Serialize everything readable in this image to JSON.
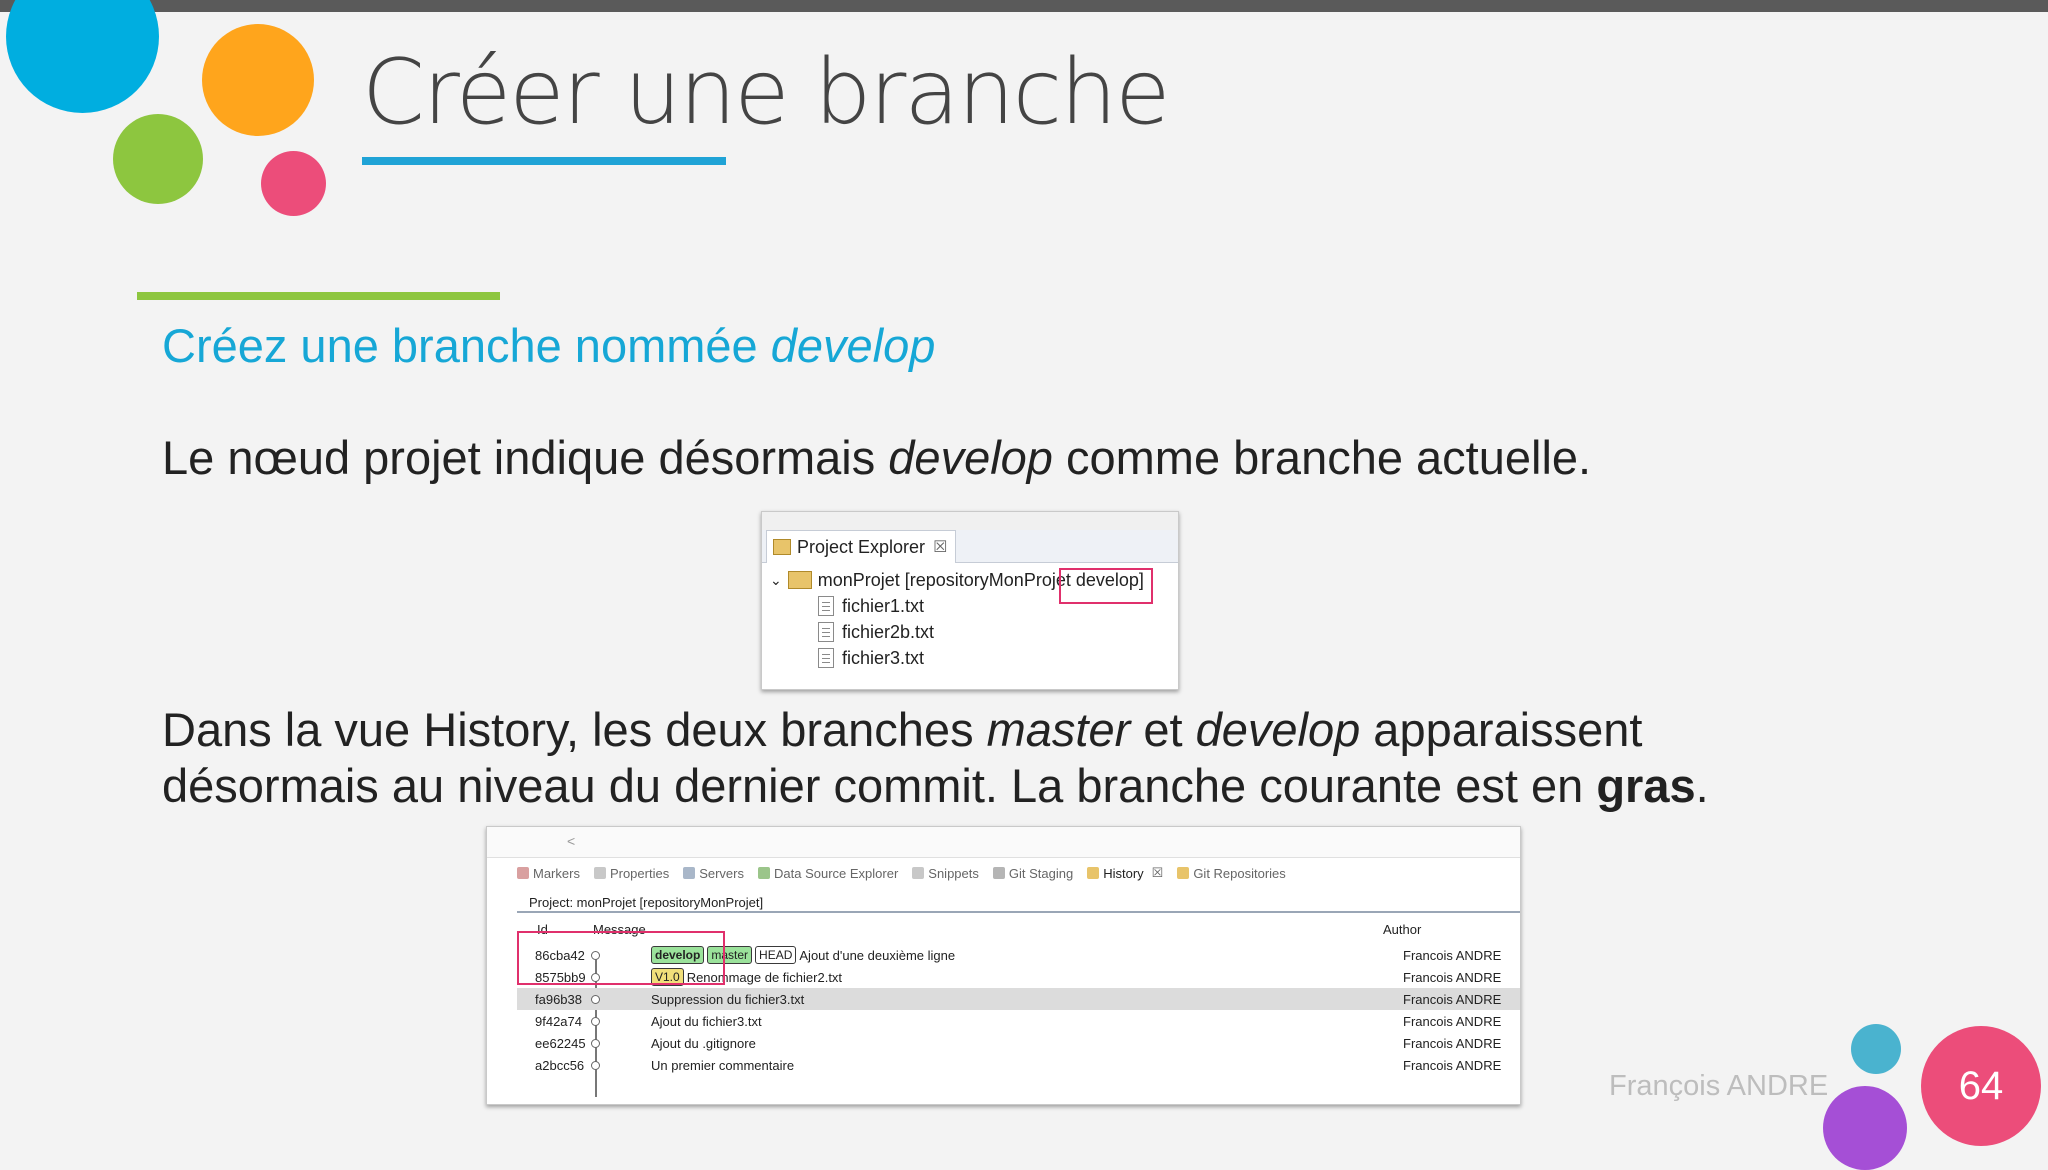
{
  "slide": {
    "title": "Créer une branche",
    "subtitle_prefix": "Créez une branche nommée ",
    "subtitle_em": "develop",
    "para1": {
      "a": "Le nœud projet indique désormais ",
      "em": "develop",
      "b": " comme branche actuelle."
    },
    "para2": {
      "line1_a": "Dans la vue History, les deux branches ",
      "line1_em1": "master",
      "line1_b": " et ",
      "line1_em2": "develop",
      "line1_c": " apparaissent",
      "line2_a": "désormais au niveau du dernier commit. La branche courante est en ",
      "line2_bold": "gras",
      "line2_end": "."
    },
    "author": "François ANDRE",
    "page_number": "64",
    "colors": {
      "blue": "#00aee0",
      "orange": "#ffa51c",
      "green": "#8dc63f",
      "pink": "#ec4d7a",
      "teal": "#4ab3cf",
      "purple": "#a54fd6",
      "subtitle": "#16a7d6"
    }
  },
  "project_explorer": {
    "tab_label": "Project Explorer",
    "tab_close": "☒",
    "project_node": "monProjet [repositoryMonProjet develop]",
    "files": [
      "fichier1.txt",
      "fichier2b.txt",
      "fichier3.txt"
    ]
  },
  "history": {
    "scroll_arrow": "<",
    "tabs": [
      "Markers",
      "Properties",
      "Servers",
      "Data Source Explorer",
      "Snippets",
      "Git Staging",
      "History",
      "Git Repositories"
    ],
    "active_tab": "History",
    "project_label": "Project: monProjet [repositoryMonProjet]",
    "columns": {
      "id": "Id",
      "message": "Message",
      "author": "Author"
    },
    "rows": [
      {
        "id": "86cba42",
        "tags": [
          "develop",
          "master",
          "HEAD"
        ],
        "message": "Ajout d'une deuxième ligne",
        "author": "Francois ANDRE"
      },
      {
        "id": "8575bb9",
        "tags": [
          "V1.0"
        ],
        "message": "Renommage de fichier2.txt",
        "author": "Francois ANDRE"
      },
      {
        "id": "fa96b38",
        "tags": [],
        "message": "Suppression du fichier3.txt",
        "author": "Francois ANDRE"
      },
      {
        "id": "9f42a74",
        "tags": [],
        "message": "Ajout du fichier3.txt",
        "author": "Francois ANDRE"
      },
      {
        "id": "ee62245",
        "tags": [],
        "message": "Ajout du .gitignore",
        "author": "Francois ANDRE"
      },
      {
        "id": "a2bcc56",
        "tags": [],
        "message": "Un premier commentaire",
        "author": "Francois ANDRE"
      }
    ]
  }
}
